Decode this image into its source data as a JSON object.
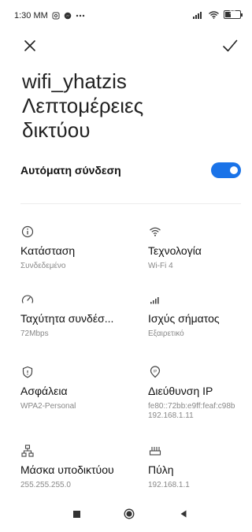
{
  "status_bar": {
    "time": "1:30 MM",
    "icons": [
      "screenshot-icon",
      "messenger-icon",
      "more-notifications-icon",
      "signal-icon",
      "wifi-icon",
      "battery-icon"
    ],
    "battery_level": "37"
  },
  "toolbar": {
    "close_icon": "close-icon",
    "confirm_icon": "check-icon"
  },
  "header": {
    "title_line1": "wifi_yhatzis",
    "title_line2": "Λεπτομέρειες",
    "title_line3": "δικτύου"
  },
  "auto_connect": {
    "label": "Αυτόματη σύνδεση",
    "enabled": true,
    "accent": "#1a73e8"
  },
  "details": [
    {
      "icon": "info-icon",
      "label": "Κατάσταση",
      "value": "Συνδεδεμένο"
    },
    {
      "icon": "wifi-icon",
      "label": "Τεχνολογία",
      "value": "Wi-Fi 4"
    },
    {
      "icon": "speed-gauge-icon",
      "label": "Ταχύτητα συνδέσ...",
      "value": "72Mbps"
    },
    {
      "icon": "signal-bars-icon",
      "label": "Ισχύς σήματος",
      "value": "Εξαιρετικό"
    },
    {
      "icon": "shield-icon",
      "label": "Ασφάλεια",
      "value": "WPA2-Personal"
    },
    {
      "icon": "ip-location-icon",
      "label": "Διεύθυνση IP",
      "value": "fe80::72bb:e9ff:feaf:c98b",
      "value2": "192.168.1.11"
    },
    {
      "icon": "network-tree-icon",
      "label": "Μάσκα υποδικτύου",
      "value": "255.255.255.0"
    },
    {
      "icon": "router-icon",
      "label": "Πύλη",
      "value": "192.168.1.1"
    }
  ],
  "nav_bar": {
    "recents": "recents-icon",
    "home": "home-icon",
    "back": "back-icon"
  }
}
